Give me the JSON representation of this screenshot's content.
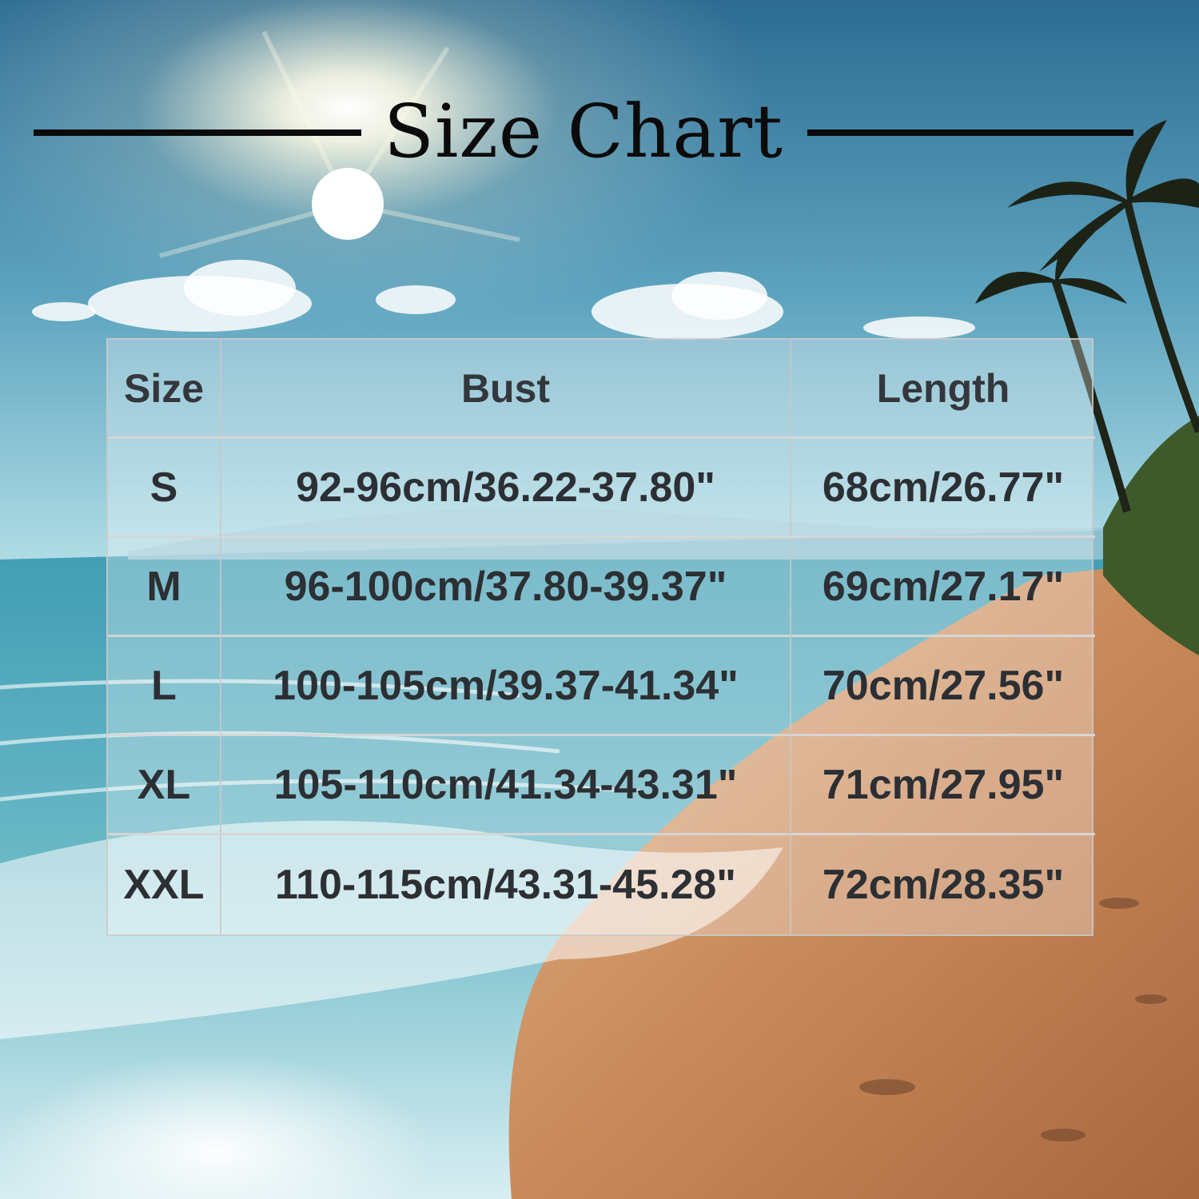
{
  "title": "Size Chart",
  "headers": [
    "Size",
    "Bust",
    "Length"
  ],
  "rows": [
    {
      "size": "S",
      "bust": "92-96cm/36.22-37.80\"",
      "length": "68cm/26.77\""
    },
    {
      "size": "M",
      "bust": "96-100cm/37.80-39.37\"",
      "length": "69cm/27.17\""
    },
    {
      "size": "L",
      "bust": "100-105cm/39.37-41.34\"",
      "length": "70cm/27.56\""
    },
    {
      "size": "XL",
      "bust": "105-110cm/41.34-43.31\"",
      "length": "71cm/27.95\""
    },
    {
      "size": "XXL",
      "bust": "110-115cm/43.31-45.28\"",
      "length": "72cm/28.35\""
    }
  ],
  "colors": {
    "sky_top": "#2f6f94",
    "sky_mid": "#7ec3d6",
    "sea": "#3f96a8",
    "sand": "#c98a5a",
    "text": "#2c2f33",
    "title": "#0b0b0b"
  }
}
